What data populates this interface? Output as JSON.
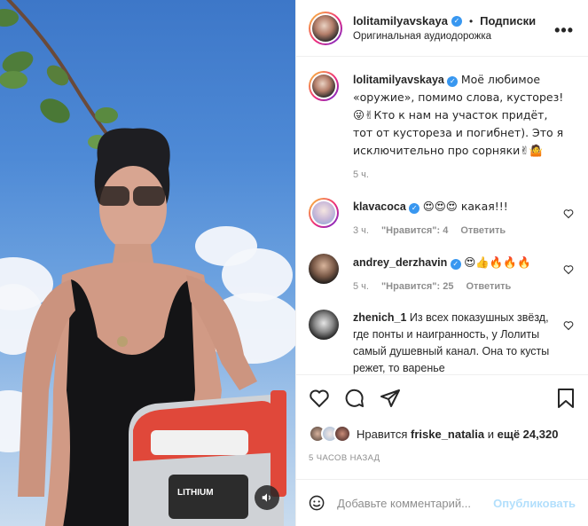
{
  "header": {
    "username": "lolitamilyavskaya",
    "separator": "•",
    "follow_label": "Подписки",
    "audio_label": "Оригинальная аудиодорожка",
    "more_label": "•••"
  },
  "caption": {
    "username": "lolitamilyavskaya",
    "text": "Моё любимое «оружие», помимо слова, кусторез! 😜✌Кто к нам на участок придёт, тот от кустореза и погибнет). Это я исключительно про сорняки✌🤷",
    "time": "5 ч."
  },
  "comments": [
    {
      "username": "klavacoca",
      "text": "😍😍😍 какая!!!",
      "time": "3 ч.",
      "likes": "\"Нравится\": 4",
      "reply": "Ответить"
    },
    {
      "username": "andrey_derzhavin",
      "text": "😍👍🔥🔥🔥",
      "time": "5 ч.",
      "likes": "\"Нравится\": 25",
      "reply": "Ответить"
    },
    {
      "username": "zhenich_1",
      "text": "Из всех показушных звёзд, где понты и наигранность, у Лолиты самый душевный канал. Она то кусты режет, то варенье",
      "time": "",
      "likes": "",
      "reply": ""
    }
  ],
  "likes": {
    "prefix": "Нравится",
    "user": "friske_natalia",
    "middle": "и",
    "more": "ещё 24,320"
  },
  "post_time": "5 часов назад",
  "add_comment": {
    "placeholder": "Добавьте комментарий...",
    "publish_label": "Опубликовать"
  },
  "colors": {
    "verified": "#3897f0",
    "story_ring": "#ee2a7b",
    "publish": "#b2dffc"
  },
  "icons": [
    "verified-icon",
    "more-icon",
    "heart-icon",
    "comment-icon",
    "share-icon",
    "bookmark-icon",
    "emoji-icon",
    "sound-icon"
  ]
}
